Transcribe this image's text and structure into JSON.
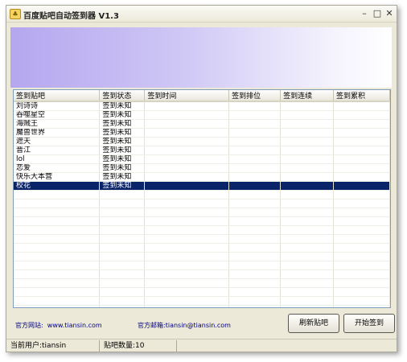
{
  "window": {
    "title": "百度贴吧自动签到器 V1.3"
  },
  "table": {
    "columns": [
      "签到贴吧",
      "签到状态",
      "签到时间",
      "签到排位",
      "签到连续",
      "签到累积"
    ],
    "rows": [
      [
        "刘诗诗",
        "签到未知",
        "",
        "",
        "",
        ""
      ],
      [
        "吞噬星空",
        "签到未知",
        "",
        "",
        "",
        ""
      ],
      [
        "海贼王",
        "签到未知",
        "",
        "",
        "",
        ""
      ],
      [
        "魔兽世界",
        "签到未知",
        "",
        "",
        "",
        ""
      ],
      [
        "遮天",
        "签到未知",
        "",
        "",
        "",
        ""
      ],
      [
        "晋江",
        "签到未知",
        "",
        "",
        "",
        ""
      ],
      [
        "lol",
        "签到未知",
        "",
        "",
        "",
        ""
      ],
      [
        "恋爱",
        "签到未知",
        "",
        "",
        "",
        ""
      ],
      [
        "快乐大本营",
        "签到未知",
        "",
        "",
        "",
        ""
      ],
      [
        "校花",
        "签到未知",
        "",
        "",
        "",
        ""
      ]
    ],
    "selected_row": 9,
    "empty_rows": 14
  },
  "footer": {
    "website_label": "官方网站:",
    "website": "www.tiansin.com",
    "email_label": "官方邮箱:",
    "email": "tiansin@tiansin.com",
    "refresh_button": "刷新贴吧",
    "start_button": "开始签到"
  },
  "status": {
    "current_user": "当前用户:tiansin",
    "bar_count": "贴吧数量:10"
  },
  "colors": {
    "selection": "#0a246a",
    "link": "#000080",
    "banner_start": "#b5a7ef"
  }
}
